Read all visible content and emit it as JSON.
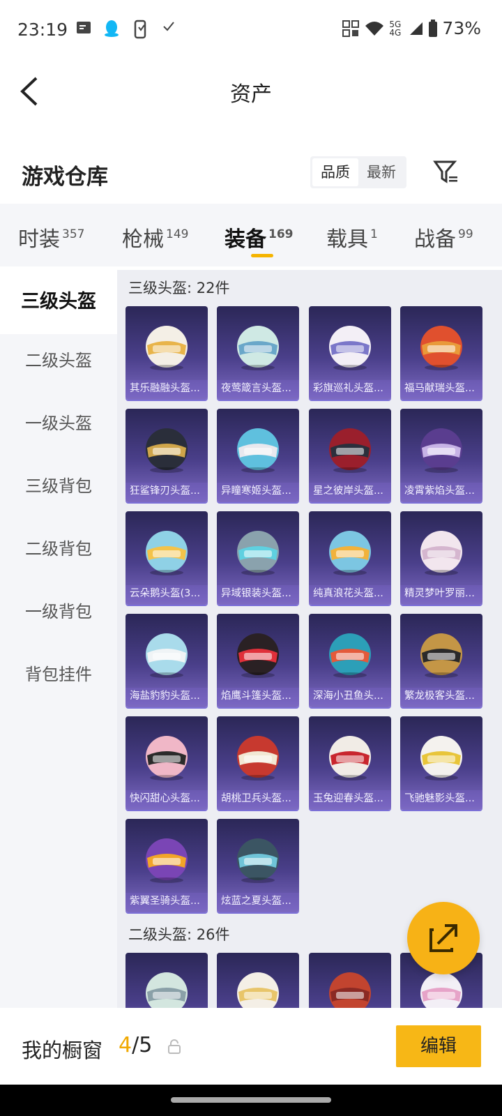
{
  "status_bar": {
    "time": "23:19",
    "network": "5G\n4G",
    "battery": "73%"
  },
  "header": {
    "title": "资产"
  },
  "warehouse": {
    "title": "游戏仓库",
    "sort_options": [
      "品质",
      "最新"
    ]
  },
  "tabs": [
    {
      "label": "时装",
      "count": "357"
    },
    {
      "label": "枪械",
      "count": "149"
    },
    {
      "label": "装备",
      "count": "169"
    },
    {
      "label": "载具",
      "count": "1"
    },
    {
      "label": "战备",
      "count": "99"
    }
  ],
  "sidebar": [
    "三级头盔",
    "二级头盔",
    "一级头盔",
    "三级背包",
    "二级背包",
    "一级背包",
    "背包挂件"
  ],
  "sections": [
    {
      "label": "三级头盔: 22件"
    },
    {
      "label": "二级头盔: 26件"
    }
  ],
  "items": [
    {
      "name": "其乐融融头盔...",
      "colors": [
        "#f4efe6",
        "#e8b44a"
      ]
    },
    {
      "name": "夜莺箴言头盔...",
      "colors": [
        "#cfe9e4",
        "#6aa7c9"
      ]
    },
    {
      "name": "彩旗巡礼头盔...",
      "colors": [
        "#f3eff6",
        "#7b77c9"
      ]
    },
    {
      "name": "福马献瑞头盔...",
      "colors": [
        "#e0502e",
        "#e99a3a"
      ]
    },
    {
      "name": "狂鲨锋刃头盔...",
      "colors": [
        "#2a2e3a",
        "#cfa54a"
      ]
    },
    {
      "name": "异瞳寒姬头盔...",
      "colors": [
        "#5fc0de",
        "#e8e8ee"
      ]
    },
    {
      "name": "星之彼岸头盔...",
      "colors": [
        "#9a1f2c",
        "#2b2f3c"
      ]
    },
    {
      "name": "凌霄紫焰头盔...",
      "colors": [
        "#5a3d8f",
        "#c7b3e6"
      ]
    },
    {
      "name": "云朵鹅头盔(3...",
      "colors": [
        "#8fd1e6",
        "#f3c34a"
      ]
    },
    {
      "name": "异域银装头盔...",
      "colors": [
        "#8aa2ad",
        "#5fd0e0"
      ]
    },
    {
      "name": "纯真浪花头盔...",
      "colors": [
        "#7cc6e2",
        "#f1b23b"
      ]
    },
    {
      "name": "精灵梦叶罗丽...",
      "colors": [
        "#f2e6ee",
        "#d5b6cf"
      ]
    },
    {
      "name": "海盐豹豹头盔...",
      "colors": [
        "#a9dbeb",
        "#f0f4f6"
      ]
    },
    {
      "name": "焰鹰斗篷头盔...",
      "colors": [
        "#2a2124",
        "#e0303a"
      ]
    },
    {
      "name": "深海小丑鱼头...",
      "colors": [
        "#2c9fb8",
        "#e45a3a"
      ]
    },
    {
      "name": "繁龙极客头盔...",
      "colors": [
        "#c49646",
        "#2a2a2a"
      ]
    },
    {
      "name": "快闪甜心头盔...",
      "colors": [
        "#f0b7c7",
        "#2b2b2b"
      ]
    },
    {
      "name": "胡桃卫兵头盔...",
      "colors": [
        "#c7392f",
        "#f2e8d4"
      ]
    },
    {
      "name": "玉兔迎春头盔...",
      "colors": [
        "#f1ece6",
        "#c8262e"
      ]
    },
    {
      "name": "飞驰魅影头盔...",
      "colors": [
        "#f4f2ee",
        "#e8c53a"
      ]
    },
    {
      "name": "紫翼圣骑头盔...",
      "colors": [
        "#7a45b5",
        "#f2a528"
      ]
    },
    {
      "name": "炫蓝之夏头盔...",
      "colors": [
        "#3b5563",
        "#6fc4d8"
      ]
    }
  ],
  "next_items": [
    {
      "colors": [
        "#d3e6df",
        "#8aa0a8"
      ]
    },
    {
      "colors": [
        "#f4efe6",
        "#e8c56a"
      ]
    },
    {
      "colors": [
        "#c2442f",
        "#8b2a24"
      ]
    },
    {
      "colors": [
        "#f3eff6",
        "#e6a3c8"
      ]
    }
  ],
  "bottom": {
    "label": "我的橱窗",
    "current": "4",
    "total": "/5",
    "edit": "编辑"
  }
}
